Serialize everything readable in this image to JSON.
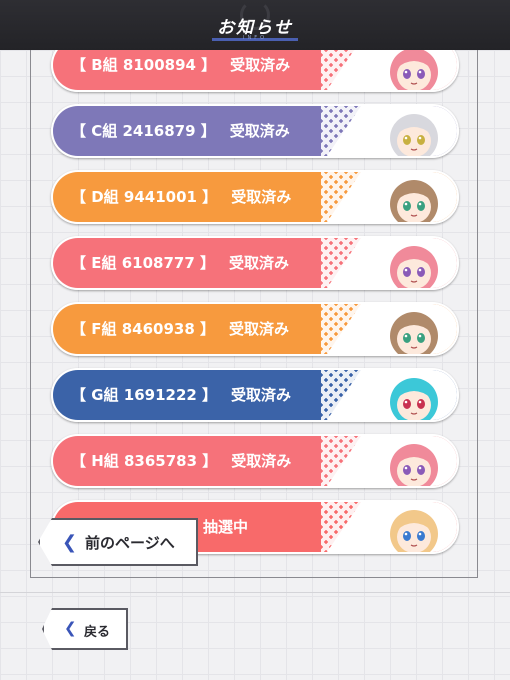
{
  "header": {
    "title": "お知らせ",
    "subtitle": "INFO"
  },
  "list": {
    "items": [
      {
        "label": "【 B組 8100894 】",
        "status": "受取済み",
        "color": "#f6727a",
        "character": "pink-haired-girl"
      },
      {
        "label": "【 C組 2416879 】",
        "status": "受取済み",
        "color": "#7e78b8",
        "character": "silver-haired-girl"
      },
      {
        "label": "【 D組 9441001 】",
        "status": "受取済み",
        "color": "#f79a3e",
        "character": "brown-haired-girl"
      },
      {
        "label": "【 E組 6108777 】",
        "status": "受取済み",
        "color": "#f6727a",
        "character": "pink-haired-girl"
      },
      {
        "label": "【 F組 8460938 】",
        "status": "受取済み",
        "color": "#f79a3e",
        "character": "brown-haired-girl"
      },
      {
        "label": "【 G組 1691222 】",
        "status": "受取済み",
        "color": "#3b63a8",
        "character": "teal-haired-boy"
      },
      {
        "label": "【 H組 8365783 】",
        "status": "受取済み",
        "color": "#f6727a",
        "character": "pink-haired-girl"
      },
      {
        "label": "",
        "status": "抽選中",
        "color": "#f86a6a",
        "character": "blonde-haired-girl"
      }
    ]
  },
  "prev_page": {
    "label": "前のページへ"
  },
  "back": {
    "label": "戻る"
  }
}
